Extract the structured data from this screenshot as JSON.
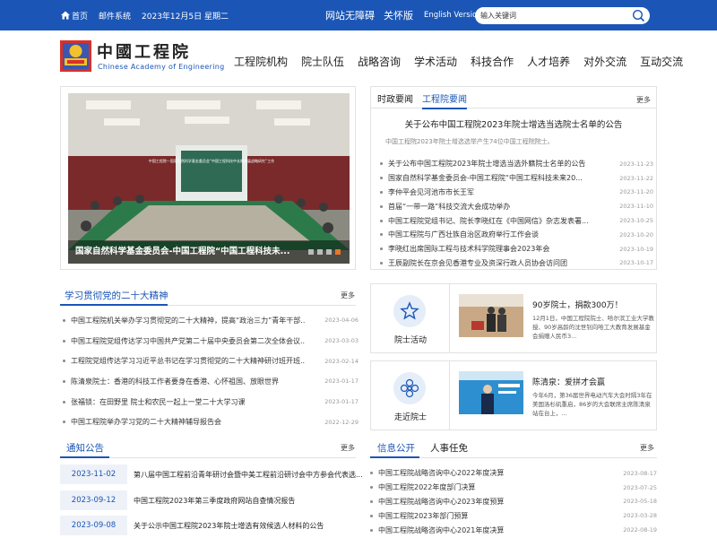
{
  "topbar": {
    "home": "首页",
    "mail": "邮件系统",
    "date": "2023年12月5日 星期二",
    "accessible": "网站无障碍",
    "care": "关怀版",
    "english": "English Version",
    "search_placeholder": "输入关键词"
  },
  "header": {
    "logo_cn": "中國工程院",
    "logo_en": "Chinese Academy of Engineering",
    "nav": [
      "工程院机构",
      "院士队伍",
      "战略咨询",
      "学术活动",
      "科技合作",
      "人才培养",
      "对外交流",
      "互动交流"
    ]
  },
  "slider": {
    "caption": "国家自然科学基金委员会-中国工程院“中国工程科技未...",
    "screen_text": "中国工程院—国家自然科学基金委员会“中国工程科技中长期发展战略研究”工作"
  },
  "news": {
    "tabs": [
      "时政要闻",
      "工程院要闻"
    ],
    "more": "更多",
    "headline": "关于公布中国工程院2023年院士增选当选院士名单的公告",
    "headline_sub": "中国工程院2023年院士增选选举产生74位中国工程院院士。",
    "items": [
      {
        "title": "关于公布中国工程院2023年院士增选当选外籍院士名单的公告",
        "date": "2023-11-23"
      },
      {
        "title": "国家自然科学基金委员会-中国工程院“中国工程科技未来20...",
        "date": "2023-11-22"
      },
      {
        "title": "李仲平会见河池市市长王军",
        "date": "2023-11-20"
      },
      {
        "title": "首届“一带一路”科技交流大会成功举办",
        "date": "2023-11-10"
      },
      {
        "title": "中国工程院党组书记、院长李晓红在《中国网信》杂志发表署...",
        "date": "2023-10-25"
      },
      {
        "title": "中国工程院与广西壮族自治区政府举行工作会谈",
        "date": "2023-10-20"
      },
      {
        "title": "李晓红出席国际工程与技术科学院理事会2023年会",
        "date": "2023-10-19"
      },
      {
        "title": "王辰副院长在京会见香港专业及资深行政人员协会访问团",
        "date": "2023-10-17"
      }
    ]
  },
  "study": {
    "title": "学习贯彻党的二十大精神",
    "more": "更多",
    "items": [
      {
        "title": "中国工程院机关举办学习贯彻党的二十大精神，提高“政治三力”青年干部...",
        "date": "2023-04-06"
      },
      {
        "title": "中国工程院党组传达学习中国共产党第二十届中央委员会第二次全体会议...",
        "date": "2023-03-03"
      },
      {
        "title": "工程院党组传达学习习近平总书记在学习贯彻党的二十大精神研讨班开班...",
        "date": "2023-02-14"
      },
      {
        "title": "陈清泉院士：香港的科技工作者要身在香港、心怀祖国、放眼世界",
        "date": "2023-01-17"
      },
      {
        "title": "张福锁：在田野里 院士和农民一起上一堂二十大学习课",
        "date": "2023-01-17"
      },
      {
        "title": "中国工程院举办学习党的二十大精神辅导报告会",
        "date": "2022-12-29"
      }
    ]
  },
  "cards": [
    {
      "label": "院士活动",
      "title": "90岁院士，捐款300万！",
      "desc": "12月1日，中国工程院院士、哈尔滨工业大学教授、90岁高龄的沈世钊向哈工大教育发展基金会捐赠人民币3..."
    },
    {
      "label": "走近院士",
      "title": "陈清泉：爱拼才会赢",
      "desc": "今年6月，第36届世界电动汽车大会时隔3年在美国洛杉矶重启，86岁的大会联席主席陈清泉站在台上，..."
    }
  ],
  "notices": {
    "title": "通知公告",
    "more": "更多",
    "items": [
      {
        "date": "2023-11-02",
        "title": "第八届中国工程前沿青年研讨会暨中美工程前沿研讨会中方参会代表选..."
      },
      {
        "date": "2023-09-12",
        "title": "中国工程院2023年第三季度政府网站自查情况报告"
      },
      {
        "date": "2023-09-08",
        "title": "关于公示中国工程院2023年院士增选有效候选人材料的公告"
      }
    ]
  },
  "info": {
    "tabs": [
      "信息公开",
      "人事任免"
    ],
    "more": "更多",
    "items": [
      {
        "title": "中国工程院战略咨询中心2022年度决算",
        "date": "2023-08-17"
      },
      {
        "title": "中国工程院2022年度部门决算",
        "date": "2023-07-25"
      },
      {
        "title": "中国工程院战略咨询中心2023年度预算",
        "date": "2023-05-18"
      },
      {
        "title": "中国工程院2023年部门预算",
        "date": "2023-03-28"
      },
      {
        "title": "中国工程院战略咨询中心2021年度决算",
        "date": "2022-08-19"
      }
    ]
  },
  "colors": {
    "primary": "#1b56b6",
    "accent": "#e8752a"
  }
}
